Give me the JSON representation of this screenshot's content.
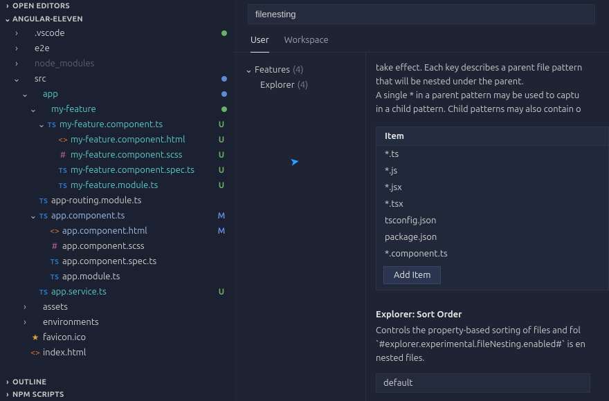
{
  "sidebar": {
    "sections": {
      "openEditors": "OPEN EDITORS",
      "project": "ANGULAR-ELEVEN",
      "outline": "OUTLINE",
      "npm": "NPM SCRIPTS"
    },
    "tree": [
      {
        "label": ".vscode",
        "type": "folder",
        "chev": ">",
        "indent": 18,
        "status": "dot-green"
      },
      {
        "label": "e2e",
        "type": "folder",
        "chev": ">",
        "indent": 18
      },
      {
        "label": "node_modules",
        "type": "folder",
        "chev": ">",
        "indent": 18,
        "muted": true
      },
      {
        "label": "src",
        "type": "folder",
        "chev": "v",
        "indent": 18,
        "status": "dot-blue"
      },
      {
        "label": "app",
        "type": "folder",
        "chev": "v",
        "indent": 30,
        "teal": true,
        "status": "dot-blue"
      },
      {
        "label": "my-feature",
        "type": "folder",
        "chev": "v",
        "indent": 42,
        "teal": true,
        "status": "dot-green"
      },
      {
        "label": "my-feature.component.ts",
        "type": "ts",
        "chev": "v",
        "indent": 54,
        "teal": true,
        "badge": "U",
        "green": true
      },
      {
        "label": "my-feature.component.html",
        "type": "html",
        "indent": 70,
        "teal": true,
        "badge": "U",
        "green": true
      },
      {
        "label": "my-feature.component.scss",
        "type": "scss",
        "indent": 70,
        "teal": true,
        "badge": "U",
        "green": true
      },
      {
        "label": "my-feature.component.spec.ts",
        "type": "ts",
        "indent": 70,
        "teal": true,
        "badge": "U",
        "green": true
      },
      {
        "label": "my-feature.module.ts",
        "type": "ts",
        "indent": 70,
        "teal": true,
        "badge": "U",
        "green": true
      },
      {
        "label": "app-routing.module.ts",
        "type": "ts",
        "indent": 42
      },
      {
        "label": "app.component.ts",
        "type": "ts",
        "chev": "v",
        "indent": 42,
        "badge": "M",
        "blue": true
      },
      {
        "label": "app.component.html",
        "type": "html",
        "indent": 58,
        "badge": "M",
        "blue": true
      },
      {
        "label": "app.component.scss",
        "type": "scss",
        "indent": 58
      },
      {
        "label": "app.component.spec.ts",
        "type": "ts",
        "indent": 58
      },
      {
        "label": "app.module.ts",
        "type": "ts",
        "indent": 58
      },
      {
        "label": "app.service.ts",
        "type": "ts",
        "indent": 42,
        "teal": true,
        "badge": "U",
        "green": true
      },
      {
        "label": "assets",
        "type": "folder",
        "chev": ">",
        "indent": 30
      },
      {
        "label": "environments",
        "type": "folder",
        "chev": ">",
        "indent": 30
      },
      {
        "label": "favicon.ico",
        "type": "star",
        "indent": 30
      },
      {
        "label": "index.html",
        "type": "html",
        "indent": 30
      }
    ]
  },
  "settings": {
    "search_value": "filenesting",
    "tabs": {
      "user": "User",
      "workspace": "Workspace"
    },
    "tree": {
      "features": {
        "label": "Features",
        "count": "(4)"
      },
      "explorer": {
        "label": "Explorer",
        "count": "(4)"
      }
    },
    "nesting": {
      "desc1": "take effect. Each key describes a parent file pattern",
      "desc2": "that will be nested under the parent.",
      "desc3a": "A single ",
      "desc3b": "*",
      "desc3c": " in a parent pattern may be used to captu",
      "desc4": "in a child pattern. Child patterns may also contain o",
      "item_header": "Item",
      "items": [
        "*.ts",
        "*.js",
        "*.jsx",
        "*.tsx",
        "tsconfig.json",
        "package.json",
        "*.component.ts"
      ],
      "add_item": "Add Item"
    },
    "sortOrder": {
      "title": "Explorer: Sort Order",
      "desc1": "Controls the property-based sorting of files and fol",
      "desc2": "`#explorer.experimental.fileNesting.enabled#` is en",
      "desc3": "nested files.",
      "value": "default"
    }
  },
  "colors": {
    "dot_green": "#6ab06a",
    "dot_blue": "#5f8bd6"
  }
}
